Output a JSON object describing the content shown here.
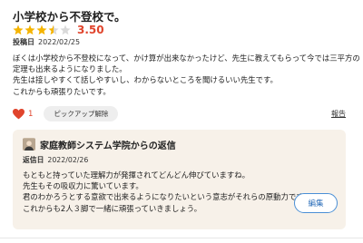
{
  "review": {
    "title": "小学校から不登校で。",
    "rating": 3.5,
    "rating_text": "3.50",
    "stars_max": 5,
    "posted_label": "投稿日",
    "posted_date": "2022/02/25",
    "body_lines": [
      "ぼくは小学校から不登校になって、かけ算が出来なかったけど、先生に教えてもらって今では三平方の",
      "定理も出来るようになりました。",
      "先生は接しやすくて話しやすいし、わからないところを聞けるいい先生です。",
      "これからも頑張りたいです。"
    ],
    "like_count": "1",
    "pickup_button": "ピックアップ解除",
    "report_link": "報告"
  },
  "reply": {
    "title": "家庭教師システム学院からの返信",
    "date_label": "返信日",
    "date": "2022/02/26",
    "body_lines": [
      "もともと持っていた理解力が発揮されてどんどん伸びていますね。",
      "先生もその吸収力に驚いています。",
      "君のわかろうとする意欲で出来るようになりたいという意志がそれらの原動力です。",
      "これからも2人３脚で一緒に頑張っていきましょう。"
    ],
    "edit_button": "編集"
  },
  "colors": {
    "star": "#f5b400",
    "star_empty": "#d9d9d9",
    "accent_red": "#e0442c",
    "reply_bg": "#f7f1e9",
    "edit_border": "#4a8fd6"
  }
}
